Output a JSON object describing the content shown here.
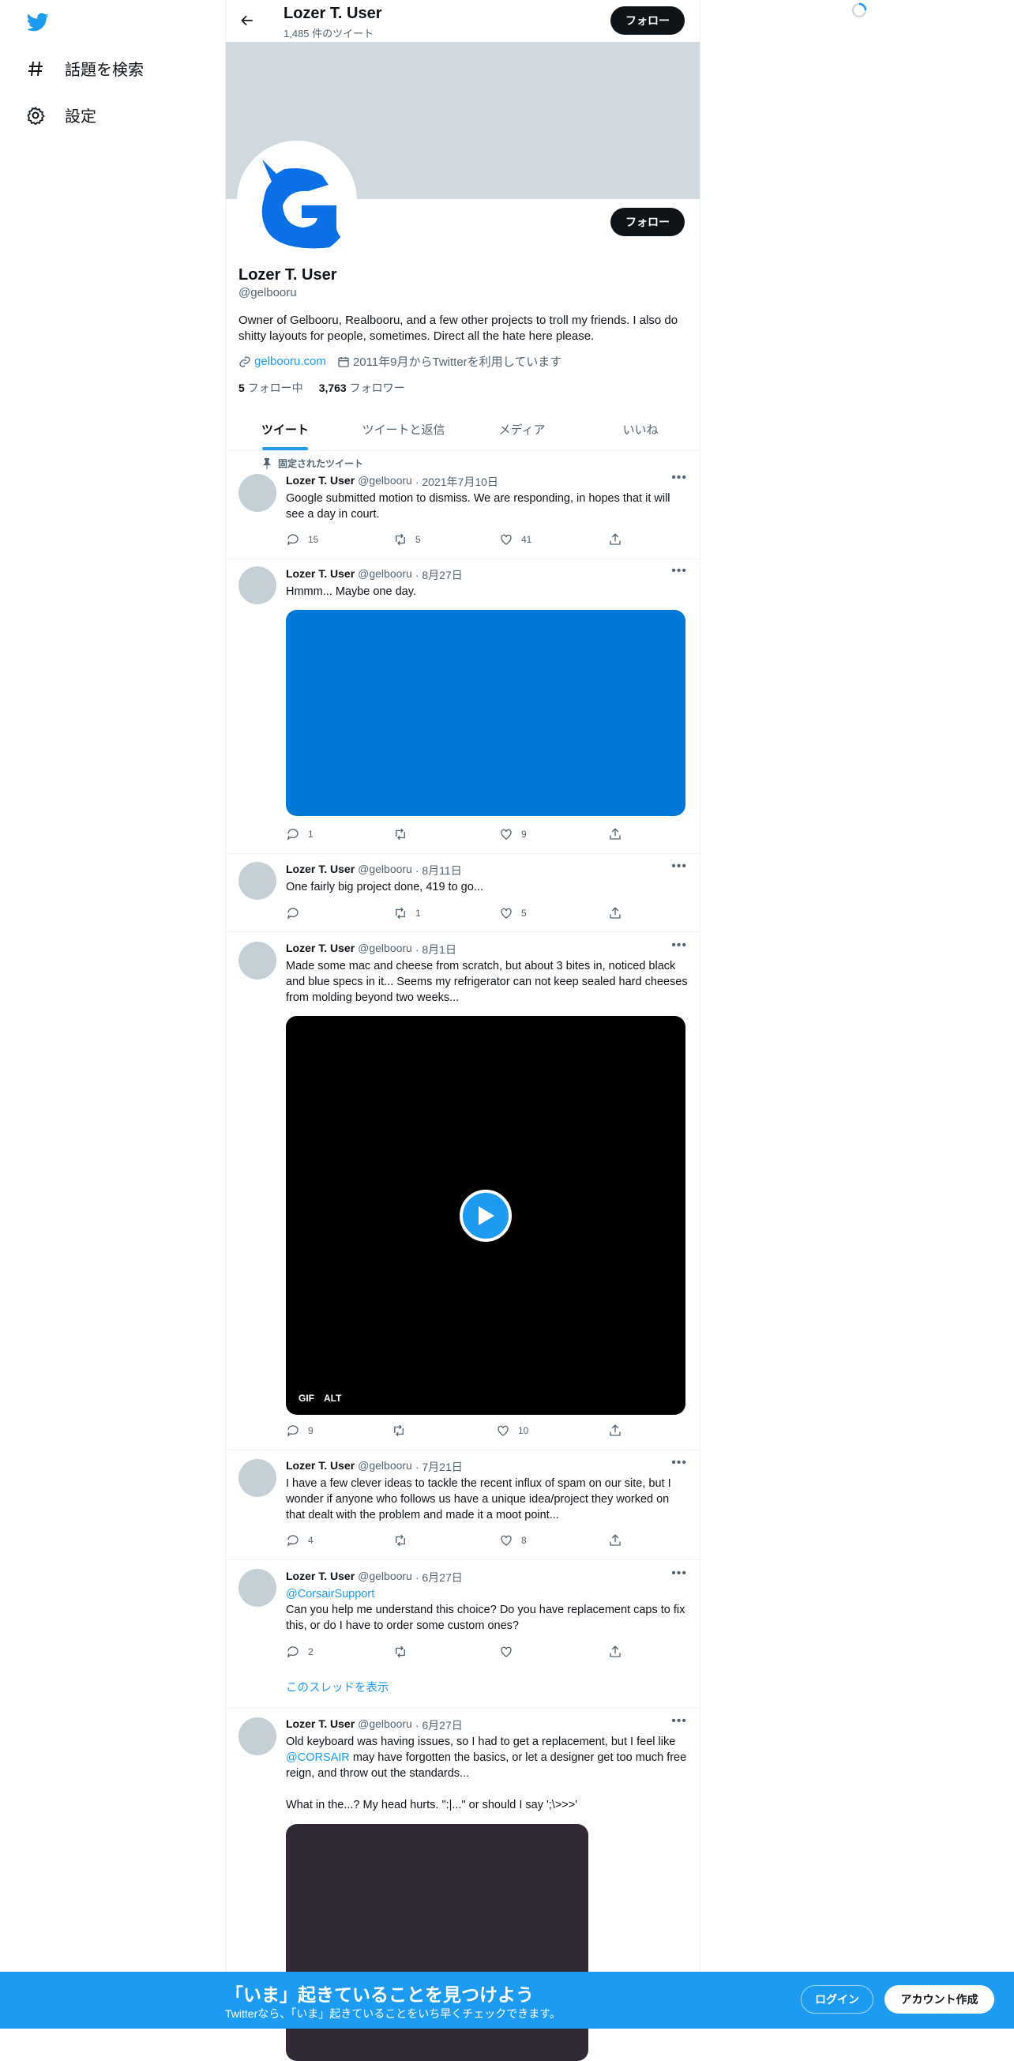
{
  "nav": {
    "items": [
      {
        "label": "話題を検索",
        "icon": "hashtag-icon"
      },
      {
        "label": "設定",
        "icon": "gear-icon"
      }
    ]
  },
  "profile": {
    "name": "Lozer T. User",
    "handle": "@gelbooru",
    "tweet_count": "1,485 件のツイート",
    "follow_label": "フォロー",
    "bio": "Owner of Gelbooru, Realbooru, and a few other projects to troll my friends. I also do shitty layouts for people, sometimes. Direct all the hate here please.",
    "website": "gelbooru.com",
    "joined": "2011年9月からTwitterを利用しています",
    "following_count": "5",
    "following_label": "フォロー中",
    "followers_count": "3,763",
    "followers_label": "フォロワー"
  },
  "tabs": [
    "ツイート",
    "ツイートと返信",
    "メディア",
    "いいね"
  ],
  "pinned_label": "固定されたツイート",
  "tweets": [
    {
      "name": "Lozer T. User",
      "handle": "@gelbooru",
      "date": "· 2021年7月10日",
      "text": "Google submitted motion to dismiss. We are responding, in hopes that it will see a day in court.",
      "replies": "15",
      "retweets": "5",
      "likes": "41"
    },
    {
      "name": "Lozer T. User",
      "handle": "@gelbooru",
      "date": "· 8月27日",
      "text": "Hmmm... Maybe one day.",
      "replies": "1",
      "retweets": "",
      "likes": "9"
    },
    {
      "name": "Lozer T. User",
      "handle": "@gelbooru",
      "date": "· 8月11日",
      "text": "One fairly big project done, 419 to go...",
      "replies": "",
      "retweets": "1",
      "likes": "5"
    },
    {
      "name": "Lozer T. User",
      "handle": "@gelbooru",
      "date": "· 8月1日",
      "text": "Made some mac and cheese from scratch, but about 3 bites in, noticed black and blue specs in it... Seems my refrigerator can not keep sealed hard cheeses from molding beyond two weeks...",
      "replies": "9",
      "retweets": "",
      "likes": "10",
      "gif_label": "GIF",
      "alt_label": "ALT"
    },
    {
      "name": "Lozer T. User",
      "handle": "@gelbooru",
      "date": "· 7月21日",
      "text": "I have a few clever ideas to tackle the recent influx of spam on our site, but I wonder if anyone who follows us have a unique idea/project they worked on that dealt with the problem and made it a moot point...",
      "replies": "4",
      "retweets": "",
      "likes": "8"
    },
    {
      "name": "Lozer T. User",
      "handle": "@gelbooru",
      "date": "· 6月27日",
      "mention": "@CorsairSupport",
      "text": "Can you help me understand this choice? Do you have replacement caps to fix this, or do I have to order some custom ones?",
      "replies": "2",
      "retweets": "",
      "likes": "",
      "thread_label": "このスレッドを表示"
    },
    {
      "name": "Lozer T. User",
      "handle": "@gelbooru",
      "date": "· 6月27日",
      "text_a": "Old keyboard was having issues, so I had to get a replacement, but I feel like ",
      "mention": "@CORSAIR",
      "text_b": " may have forgotten the basics, or let a designer get too much free reign, and throw out the standards...",
      "text_c": "What in the...? My head hurts. \":|...\" or should I say ';\\>>>'"
    }
  ],
  "bottom": {
    "title": "「いま」起きていることを見つけよう",
    "subtitle": "Twitterなら、「いま」起きていることをいち早くチェックできます。",
    "login": "ログイン",
    "signup": "アカウント作成"
  },
  "colors": {
    "accent": "#1d9bf0",
    "banner": "#cfd9de",
    "dark": "#0f1419",
    "media_blue": "#0078d7"
  }
}
